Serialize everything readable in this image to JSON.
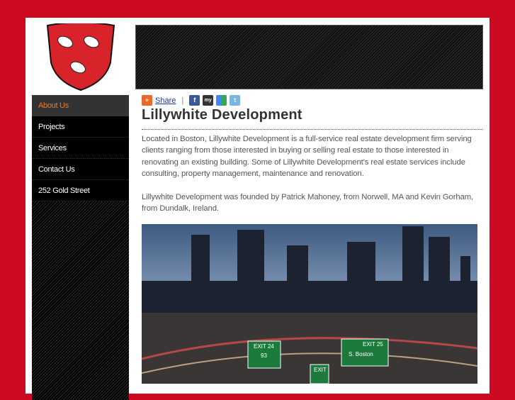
{
  "nav": {
    "items": [
      {
        "label": "About Us",
        "active": true
      },
      {
        "label": "Projects"
      },
      {
        "label": "Services"
      },
      {
        "label": "Contact Us"
      },
      {
        "label": "252 Gold Street"
      }
    ]
  },
  "share": {
    "label": "Share",
    "icons": [
      "addthis-icon",
      "facebook-icon",
      "myspace-icon",
      "google-icon",
      "twitter-icon"
    ]
  },
  "page": {
    "title": "Lillywhite Development",
    "paragraphs": [
      "Located in Boston, Lillywhite Development is a full-service real estate development firm serving clients ranging from those interested in buying or selling real estate to those interested in renovating an existing building. Some of Lillywhite Development's real estate services include consulting, property management, maintenance and renovation.",
      "Lillywhite Development was founded by Patrick Mahoney, from Norwell, MA and Kevin Gorham, from Dundalk, Ireland."
    ]
  },
  "photo": {
    "signs": [
      "EXIT 24",
      "93",
      "EXIT 25",
      "S. Boston",
      "EXIT"
    ]
  },
  "colors": {
    "background": "#cc0a22",
    "active_nav": "#e8792a"
  }
}
